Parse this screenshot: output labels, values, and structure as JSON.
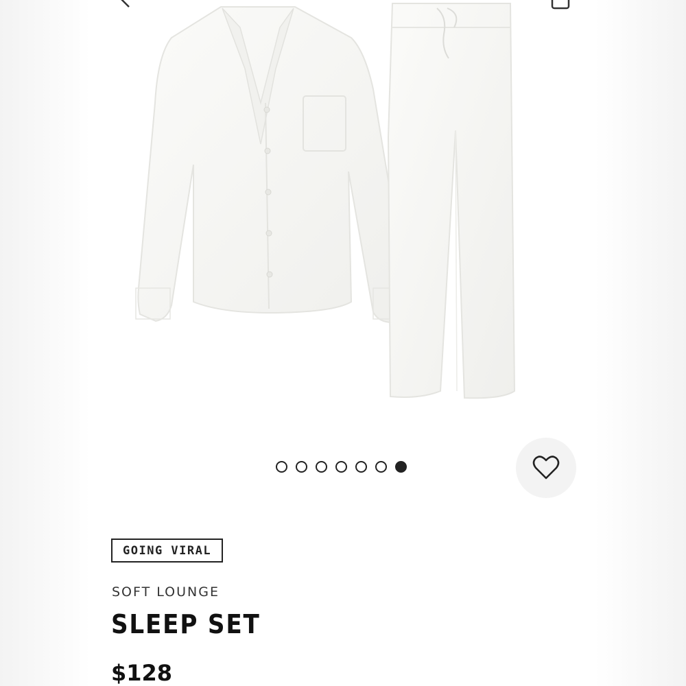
{
  "gallery": {
    "dot_count": 7,
    "active_index": 6
  },
  "icons": {
    "back": "chevron-left-icon",
    "share": "share-icon",
    "favorite": "heart-icon"
  },
  "product": {
    "badge": "GOING VIRAL",
    "collection": "SOFT LOUNGE",
    "name": "SLEEP SET",
    "price": "$128"
  },
  "colors": {
    "text": "#111111",
    "active_dot": "#222222",
    "fav_button_bg": "#f3f3f3"
  }
}
